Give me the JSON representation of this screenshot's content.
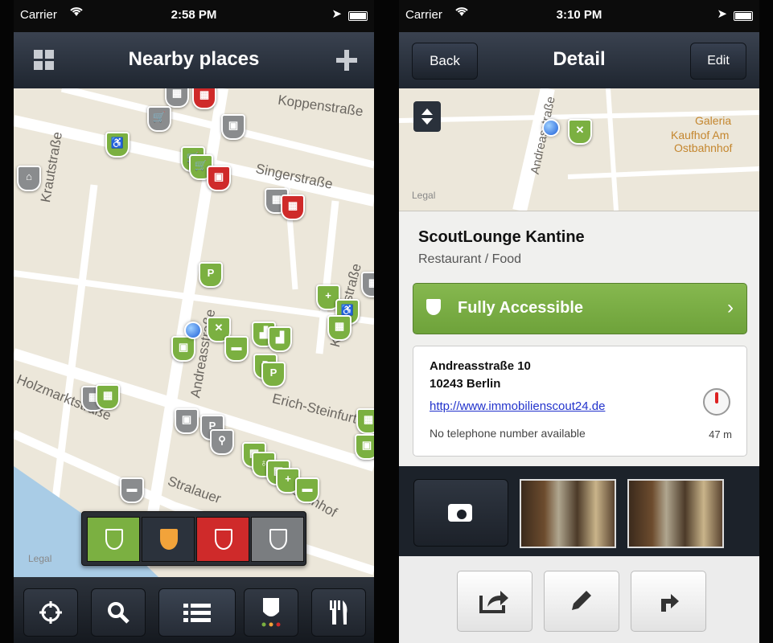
{
  "left": {
    "status": {
      "carrier": "Carrier",
      "time": "2:58 PM"
    },
    "nav": {
      "title": "Nearby places",
      "grid_icon": "grid-icon",
      "add_icon": "plus-icon"
    },
    "map": {
      "streets": [
        "Koppenstraße",
        "Singerstraße",
        "Krautstraße",
        "Koppenstraße",
        "Andreasstraße",
        "Erich-Steinfurth",
        "Holzmarktstraße",
        "Stralauer",
        "Am Ostbahnhof"
      ],
      "legal": "Legal"
    },
    "filter": {
      "swatch_colors": [
        "#7bb041",
        "#f2a33a",
        "#cf2a2a",
        "#8a8c8e"
      ]
    },
    "tabs": [
      "locate-icon",
      "search-icon",
      "list-icon",
      "accessibility-filter-icon",
      "restaurant-icon"
    ]
  },
  "right": {
    "status": {
      "carrier": "Carrier",
      "time": "3:10 PM"
    },
    "nav": {
      "back_label": "Back",
      "title": "Detail",
      "edit_label": "Edit"
    },
    "map": {
      "streets": [
        "Andreasstraße",
        "Galeria",
        "Kaufhof Am",
        "Ostbahnhof"
      ],
      "legal": "Legal"
    },
    "place": {
      "name": "ScoutLounge Kantine",
      "category": "Restaurant / Food",
      "accessibility": "Fully Accessible",
      "address_line1": "Andreasstraße 10",
      "address_line2": "10243 Berlin",
      "url": "http://www.immobilienscout24.de",
      "phone": "No telephone number available",
      "distance": "47 m"
    },
    "actions": [
      "share-icon",
      "edit-pencil-icon",
      "directions-icon"
    ]
  },
  "colors": {
    "accessible_green": "#7bb041",
    "limited_orange": "#f2a33a",
    "not_accessible_red": "#cf2a2a",
    "unknown_grey": "#8a8c8e"
  }
}
